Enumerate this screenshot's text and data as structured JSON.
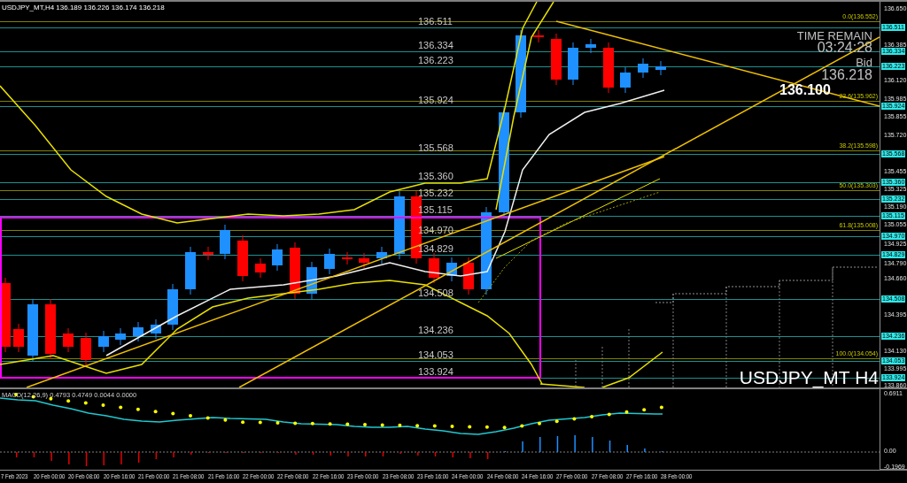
{
  "header": "USDJPY_MT,H4  136.189 136.226 136.174 136.218",
  "levels": [
    {
      "label": "136.511",
      "tag": "136.511"
    },
    {
      "label": "136.334",
      "tag": "136.334"
    },
    {
      "label": "136.223",
      "tag": "136.223"
    },
    {
      "label": "135.924",
      "tag": "135.924"
    },
    {
      "label": "135.568",
      "tag": "135.568"
    },
    {
      "label": "135.360",
      "tag": "135.360"
    },
    {
      "label": "135.232",
      "tag": "135.232"
    },
    {
      "label": "135.115",
      "tag": "135.115"
    },
    {
      "label": "134.970",
      "tag": "134.970"
    },
    {
      "label": "134.829",
      "tag": "134.829"
    },
    {
      "label": "134.508",
      "tag": "134.508"
    },
    {
      "label": "134.236",
      "tag": "134.236"
    },
    {
      "label": "134.053",
      "tag": "134.053"
    },
    {
      "label": "133.924",
      "tag": "133.924"
    }
  ],
  "fib_levels": [
    "0.0(136.552)",
    "23.6(135.962)",
    "38.2(135.598)",
    "50.0(135.303)",
    "61.8(135.008)",
    "100.0(134.054)"
  ],
  "price_axis": [
    "136.650",
    "136.385",
    "136.120",
    "135.985",
    "135.855",
    "135.720",
    "135.455",
    "135.325",
    "135.190",
    "135.055",
    "134.925",
    "134.790",
    "134.660",
    "134.395",
    "134.130",
    "133.995",
    "133.860"
  ],
  "time_remain": {
    "title": "TIME REMAIN",
    "value": "03:24:28"
  },
  "bid": {
    "title": "Bid",
    "value": "136.218"
  },
  "price_marker": "136.100",
  "symbol_label": "USDJPY_MT H4",
  "macd": {
    "label": "MACD(12,26,9) 0.4793 0.4749 0.0044 0.0000",
    "axis": [
      "0.6911",
      "0.00",
      "-0.1969"
    ]
  },
  "time_axis": [
    "7 Feb 2023",
    "20 Feb 00:00",
    "20 Feb 08:00",
    "20 Feb 16:00",
    "21 Feb 00:00",
    "21 Feb 08:00",
    "21 Feb 16:00",
    "22 Feb 00:00",
    "22 Feb 08:00",
    "22 Feb 16:00",
    "23 Feb 00:00",
    "23 Feb 08:00",
    "23 Feb 16:00",
    "24 Feb 00:00",
    "24 Feb 08:00",
    "24 Feb 16:00",
    "27 Feb 00:00",
    "27 Feb 08:00",
    "27 Feb 16:00",
    "28 Feb 00:00"
  ]
}
